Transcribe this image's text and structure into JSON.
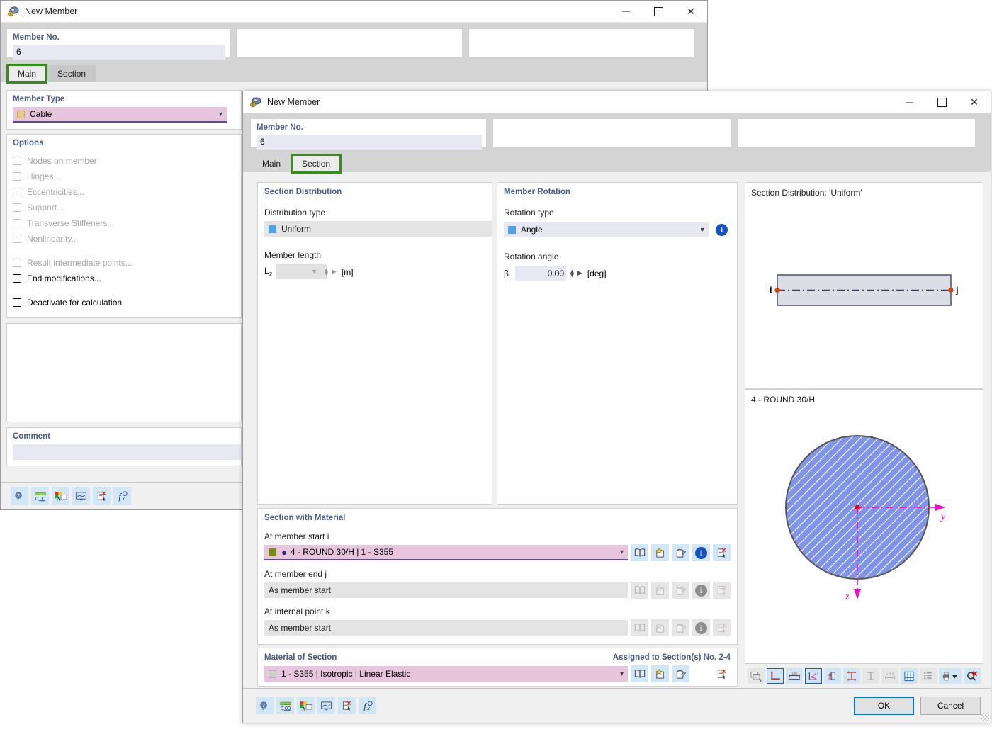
{
  "background_window": {
    "title": "New Member",
    "icon": "member-icon",
    "window_buttons": {
      "minimize": "minimize-icon",
      "maximize": "maximize-icon",
      "close": "close-icon"
    },
    "member_no": {
      "label": "Member No.",
      "value": "6"
    },
    "tabs": [
      {
        "label": "Main",
        "active": true
      },
      {
        "label": "Section",
        "active": false
      }
    ],
    "member_type": {
      "title": "Member Type",
      "value": "Cable",
      "swatch": "#e8c88a"
    },
    "options": {
      "title": "Options",
      "items": [
        {
          "label": "Nodes on member",
          "checked": false,
          "disabled": true
        },
        {
          "label": "Hinges...",
          "checked": false,
          "disabled": true
        },
        {
          "label": "Eccentricities...",
          "checked": false,
          "disabled": true
        },
        {
          "label": "Support...",
          "checked": false,
          "disabled": true
        },
        {
          "label": "Transverse Stiffeners...",
          "checked": false,
          "disabled": true
        },
        {
          "label": "Nonlinearity...",
          "checked": false,
          "disabled": true
        },
        {
          "label": "Result intermediate points...",
          "checked": false,
          "disabled": true
        },
        {
          "label": "End modifications...",
          "checked": false,
          "disabled": false
        },
        {
          "label": "Deactivate for calculation",
          "checked": false,
          "disabled": false
        }
      ]
    },
    "comment": {
      "label": "Comment",
      "value": ""
    },
    "toolbar": [
      {
        "name": "help-find-icon"
      },
      {
        "name": "units-decimals-icon"
      },
      {
        "name": "display-properties-icon"
      },
      {
        "name": "view-mode-icon"
      },
      {
        "name": "delete-report-icon"
      },
      {
        "name": "formula-icon"
      }
    ]
  },
  "dialog": {
    "title": "New Member",
    "icon": "member-icon",
    "window_buttons": {
      "minimize": "minimize-icon",
      "maximize": "maximize-icon",
      "close": "close-icon"
    },
    "member_no": {
      "label": "Member No.",
      "value": "6"
    },
    "tabs": [
      {
        "label": "Main",
        "active": false
      },
      {
        "label": "Section",
        "active": true
      }
    ],
    "section_distribution": {
      "title": "Section Distribution",
      "distribution_type_label": "Distribution type",
      "distribution_type_value": "Uniform",
      "member_length_label": "Member length",
      "member_length_symbol": "L",
      "member_length_subscript": "z",
      "member_length_value": "",
      "member_length_unit": "[m]"
    },
    "member_rotation": {
      "title": "Member Rotation",
      "rotation_type_label": "Rotation type",
      "rotation_type_value": "Angle",
      "rotation_angle_label": "Rotation angle",
      "rotation_angle_symbol": "β",
      "rotation_angle_value": "0.00",
      "rotation_angle_unit": "[deg]",
      "info_icon": "info-icon"
    },
    "section_with_material": {
      "title": "Section with Material",
      "rows": [
        {
          "label": "At member start i",
          "value": "4 - ROUND 30/H | 1 - S355",
          "state": "active",
          "swatch": "#7a8a12",
          "buttons": [
            "library-icon",
            "new-section-icon",
            "edit-section-icon",
            "info-icon",
            "delete-icon"
          ]
        },
        {
          "label": "At member end j",
          "value": "As member start",
          "state": "readonly",
          "buttons": [
            "library-icon",
            "new-section-icon",
            "edit-section-icon",
            "info-icon",
            "delete-icon"
          ]
        },
        {
          "label": "At internal point k",
          "value": "As member start",
          "state": "readonly",
          "buttons": [
            "library-icon",
            "new-section-icon",
            "edit-section-icon",
            "info-icon",
            "delete-icon"
          ]
        }
      ]
    },
    "material_of_section": {
      "title": "Material of Section",
      "assigned_note": "Assigned to Section(s) No. 2-4",
      "value": "1 - S355 | Isotropic | Linear Elastic",
      "buttons": [
        "library-icon",
        "new-material-icon",
        "edit-material-icon",
        "delete-icon"
      ]
    },
    "preview_distribution": {
      "title": "Section Distribution: 'Uniform'",
      "node_start": "i",
      "node_end": "j"
    },
    "preview_section": {
      "title": "4 - ROUND 30/H",
      "axis_y": "y",
      "axis_z": "z",
      "fill_color": "#8094e8",
      "outline_color": "#555555",
      "axis_color": "#ff00cc"
    },
    "preview_toolbar": [
      {
        "name": "render-mode-icon",
        "state": "off"
      },
      {
        "name": "section-outline-icon",
        "state": "selected"
      },
      {
        "name": "dimensions-icon",
        "state": "on"
      },
      {
        "name": "principal-axes-icon",
        "state": "selected"
      },
      {
        "name": "shear-center-icon",
        "state": "on"
      },
      {
        "name": "stress-points-icon",
        "state": "on"
      },
      {
        "name": "centroid-icon",
        "state": "off"
      },
      {
        "name": "numbering-icon",
        "state": "off"
      },
      {
        "name": "grid-icon",
        "state": "on"
      },
      {
        "name": "parts-list-icon",
        "state": "off"
      },
      {
        "name": "print-icon",
        "state": "on"
      },
      {
        "name": "reset-view-icon",
        "state": "on"
      }
    ],
    "toolbar": [
      {
        "name": "help-find-icon"
      },
      {
        "name": "units-decimals-icon"
      },
      {
        "name": "display-properties-icon"
      },
      {
        "name": "view-mode-icon"
      },
      {
        "name": "delete-report-icon"
      },
      {
        "name": "formula-icon"
      }
    ],
    "buttons": {
      "ok": "OK",
      "cancel": "Cancel"
    }
  }
}
